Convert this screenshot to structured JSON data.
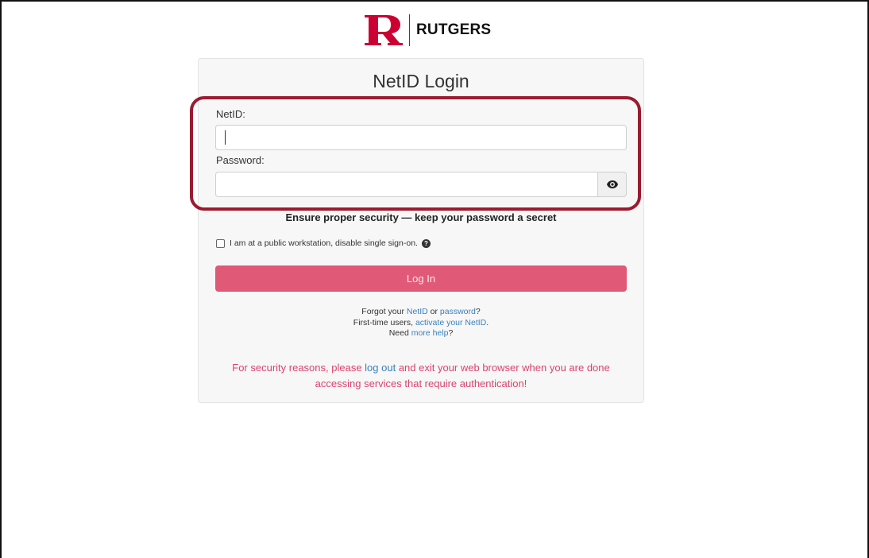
{
  "brand": {
    "name": "RUTGERS",
    "logo_icon": "rutgers-r-logo",
    "color": "#cc0033"
  },
  "card": {
    "title": "NetID Login"
  },
  "form": {
    "netid_label": "NetID:",
    "netid_value": "",
    "password_label": "Password:",
    "password_value": "",
    "show_password_icon": "eye-icon",
    "security_notice": "Ensure proper security — keep your password a secret",
    "public_workstation_label": "I am at a public workstation, disable single sign-on.",
    "public_workstation_checked": false,
    "help_icon": "question-circle-icon",
    "login_button": "Log In"
  },
  "help": {
    "line1_prefix": "Forgot your ",
    "line1_link1": "NetID",
    "line1_mid": " or ",
    "line1_link2": "password",
    "line1_suffix": "?",
    "line2_prefix": "First-time users, ",
    "line2_link": "activate your NetID",
    "line2_suffix": ".",
    "line3_prefix": "Need ",
    "line3_link": "more help",
    "line3_suffix": "?"
  },
  "warning": {
    "prefix": "For security reasons, please ",
    "link": "log out",
    "suffix_line1": " and exit your web browser when you are done",
    "line2": "accessing services that require authentication!"
  },
  "colors": {
    "highlight_border": "#9b1b30",
    "login_button": "#e05a78",
    "link": "#3a7fbf",
    "warning_text": "#d9436d"
  }
}
